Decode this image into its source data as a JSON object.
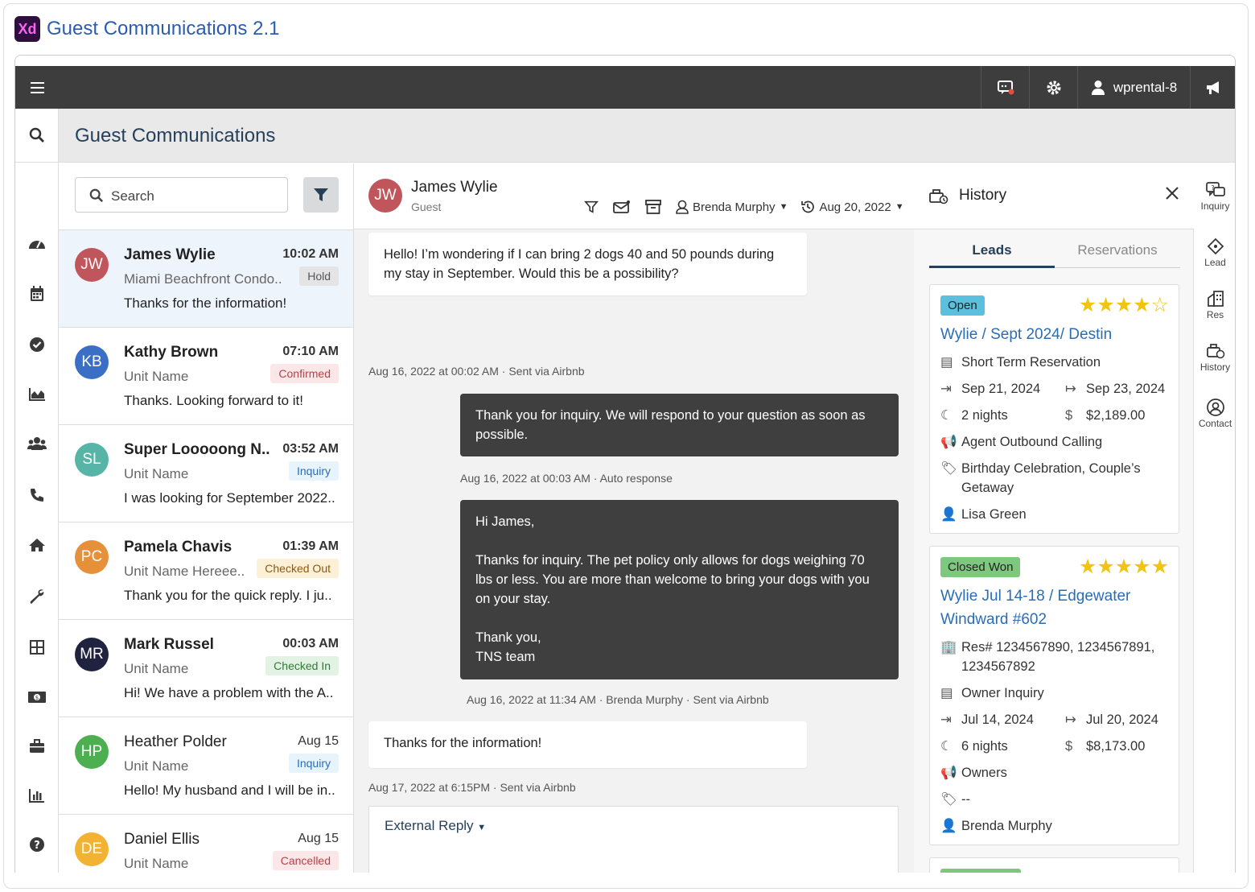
{
  "window": {
    "badge": "Xd",
    "title": "Guest Communications 2.1"
  },
  "topbar": {
    "username": "wprental-8"
  },
  "page": {
    "title": "Guest Communications"
  },
  "search": {
    "placeholder": "Search"
  },
  "conversations": [
    {
      "initials": "JW",
      "name": "James Wylie",
      "time": "10:02 AM",
      "unit": "Miami Beachfront Condo..",
      "status": "Hold",
      "preview": "Thanks for the information!",
      "color": "#c0565b",
      "badge_bg": "#e4e4e6",
      "badge_fg": "#555555",
      "unread": true,
      "active": true
    },
    {
      "initials": "KB",
      "name": "Kathy Brown",
      "time": "07:10 AM",
      "unit": "Unit Name",
      "status": "Confirmed",
      "preview": "Thanks. Looking forward to it!",
      "color": "#3b6fc6",
      "badge_bg": "#fbe7e8",
      "badge_fg": "#b54249",
      "unread": true,
      "active": false
    },
    {
      "initials": "SL",
      "name": "Super Looooong N..",
      "time": "03:52 AM",
      "unit": "Unit Name",
      "status": "Inquiry",
      "preview": "I was looking for September 2022..",
      "color": "#56b5a6",
      "badge_bg": "#e8f4fb",
      "badge_fg": "#2a6db5",
      "unread": true,
      "active": false
    },
    {
      "initials": "PC",
      "name": "Pamela Chavis",
      "time": "01:39 AM",
      "unit": "Unit Name Hereee..",
      "status": "Checked Out",
      "preview": "Thank you for the quick reply. I ju..",
      "color": "#e6913a",
      "badge_bg": "#fcf0d7",
      "badge_fg": "#8a5a12",
      "unread": true,
      "active": false
    },
    {
      "initials": "MR",
      "name": "Mark Russel",
      "time": "00:03 AM",
      "unit": "Unit Name",
      "status": "Checked In",
      "preview": "Hi! We have a problem with the A..",
      "color": "#1f2340",
      "badge_bg": "#e3f3e3",
      "badge_fg": "#2f7a35",
      "unread": true,
      "active": false
    },
    {
      "initials": "HP",
      "name": "Heather Polder",
      "time": "Aug 15",
      "unit": "Unit Name",
      "status": "Inquiry",
      "preview": "Hello! My husband and I will be in..",
      "color": "#4caf50",
      "badge_bg": "#e8f4fb",
      "badge_fg": "#2a6db5",
      "unread": false,
      "active": false
    },
    {
      "initials": "DE",
      "name": "Daniel Ellis",
      "time": "Aug 15",
      "unit": "Unit Name",
      "status": "Cancelled",
      "preview": "",
      "color": "#f2b234",
      "badge_bg": "#fbe7e8",
      "badge_fg": "#b54249",
      "unread": false,
      "active": false
    }
  ],
  "chat": {
    "initials": "JW",
    "guest_name": "James Wylie",
    "guest_role": "Guest",
    "assignee": "Brenda Murphy",
    "date": "Aug 20, 2022",
    "messages": [
      {
        "text": "Hello! I’m wondering if I can bring 2 dogs 40 and 50 pounds during my stay in September. Would this be a possibility?",
        "meta": "Aug 16, 2022 at 00:02 AM · Sent via Airbnb"
      },
      {
        "text": "Thank you for inquiry. We will respond to your question as soon as possible.",
        "meta": "Aug 16, 2022 at 00:03 AM · Auto response"
      },
      {
        "text": "Hi James,\n\nThanks for inquiry. The pet policy only allows for dogs weighing 70 lbs or less. You are more than welcome to bring your dogs with you on your stay.\n\nThank you,\nTNS team",
        "meta": "Aug 16, 2022 at 11:34 AM · Brenda Murphy · Sent via Airbnb"
      },
      {
        "text": "Thanks for the information!",
        "meta": "Aug 17, 2022 at 6:15PM · Sent via Airbnb"
      }
    ],
    "compose_mode": "External Reply"
  },
  "history": {
    "title": "History",
    "tabs": [
      "Leads",
      "Reservations"
    ],
    "cards": [
      {
        "status": "Open",
        "status_bg": "#5bc0de",
        "rating": 4,
        "title": "Wylie / Sept 2024/ Destin",
        "type": "Short Term Reservation",
        "checkin": "Sep 21, 2024",
        "checkout": "Sep 23, 2024",
        "nights": "2 nights",
        "amount": "$2,189.00",
        "source": "Agent Outbound Calling",
        "tags": "Birthday Celebration, Couple’s Getaway",
        "agent": "Lisa Green"
      },
      {
        "status": "Closed Won",
        "status_bg": "#7ec77e",
        "rating": 5,
        "title": "Wylie Jul 14-18 / Edgewater Windward #602",
        "res": "Res# 1234567890, 1234567891, 1234567892",
        "type": "Owner Inquiry",
        "checkin": "Jul 14, 2024",
        "checkout": "Jul 20, 2024",
        "nights": "6 nights",
        "amount": "$8,173.00",
        "source": "Owners",
        "tags": "--",
        "agent": "Brenda Murphy"
      }
    ]
  },
  "rightrail": [
    "Inquiry",
    "Lead",
    "Res",
    "History",
    "Contact"
  ]
}
